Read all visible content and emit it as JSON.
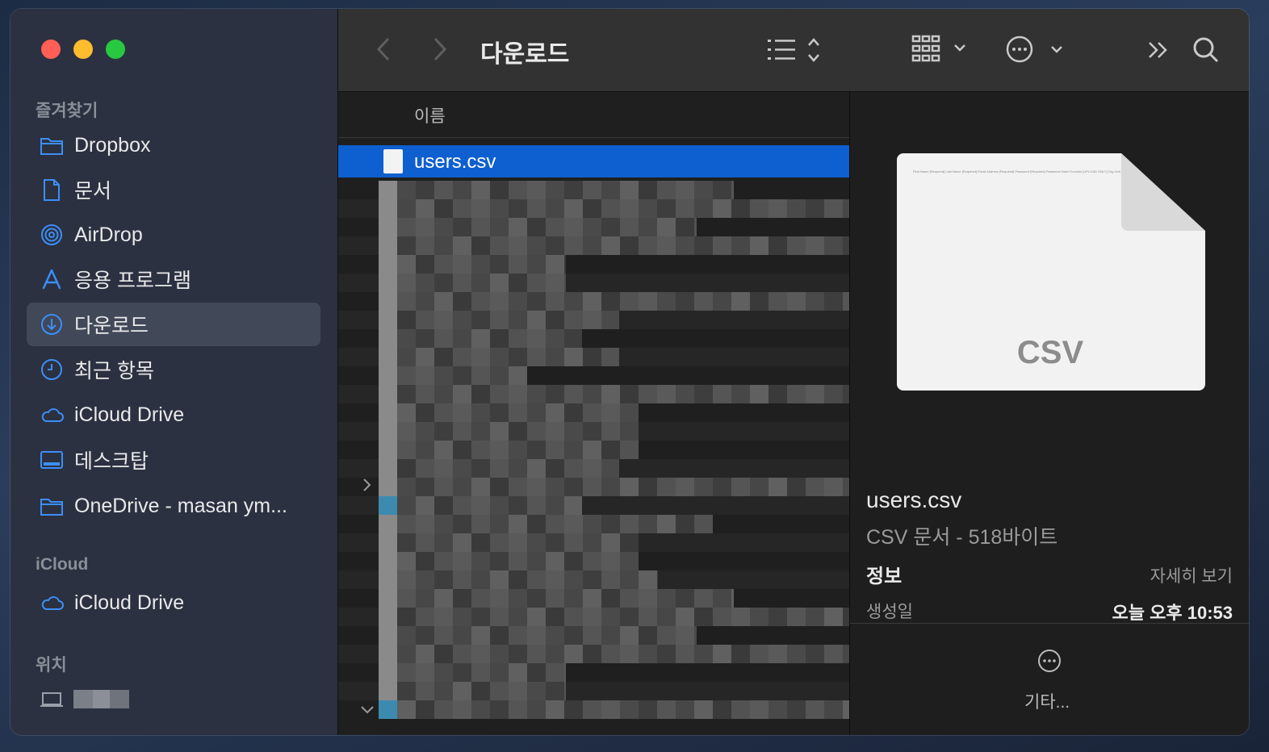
{
  "sidebar": {
    "favorites_title": "즐겨찾기",
    "items": [
      {
        "label": "Dropbox"
      },
      {
        "label": "문서"
      },
      {
        "label": "AirDrop"
      },
      {
        "label": "응용 프로그램"
      },
      {
        "label": "다운로드"
      },
      {
        "label": "최근 항목"
      },
      {
        "label": "iCloud Drive"
      },
      {
        "label": "데스크탑"
      },
      {
        "label": "OneDrive - masan ym..."
      }
    ],
    "icloud_title": "iCloud",
    "icloud_items": [
      {
        "label": "iCloud Drive"
      }
    ],
    "locations_title": "위치"
  },
  "toolbar": {
    "title": "다운로드"
  },
  "list": {
    "column_name": "이름",
    "selected_file": "users.csv"
  },
  "preview": {
    "doc_label": "CSV",
    "doc_header_text": "First Name [Required]   Last Name [Required]   Email Address [Required]   Password [Required]   Password Hash Function [UPLOAD ONLY]   Org Unit",
    "file_name": "users.csv",
    "kind": "CSV 문서 - 518바이트",
    "info_title": "정보",
    "show_more": "자세히 보기",
    "created_label": "생성일",
    "created_value": "오늘 오후 10:53",
    "more_label": "기타..."
  },
  "colors": {
    "selection": "#0e5fd0",
    "accent": "#3d8ef7"
  }
}
